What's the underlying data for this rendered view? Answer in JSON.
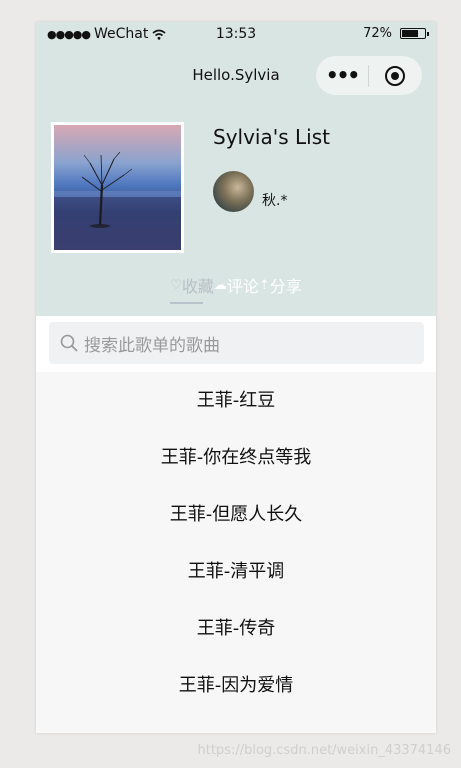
{
  "status_bar": {
    "carrier": "WeChat",
    "time": "13:53",
    "battery": "72%",
    "battery_level": 0.72
  },
  "nav": {
    "title": "Hello.Sylvia",
    "more_icon": "more-dots-icon",
    "close_icon": "target-icon"
  },
  "playlist": {
    "title": "Sylvia's List",
    "user_name": "秋.*"
  },
  "tabs": [
    {
      "icon": "♡",
      "label": "收藏"
    },
    {
      "icon": "☁",
      "label": "评论"
    },
    {
      "icon": "⇡",
      "label": "分享"
    }
  ],
  "search": {
    "placeholder": "搜索此歌单的歌曲"
  },
  "songs": [
    "王菲-红豆",
    "王菲-你在终点等我",
    "王菲-但愿人长久",
    "王菲-清平调",
    "王菲-传奇",
    "王菲-因为爱情"
  ],
  "watermark": "https://blog.csdn.net/weixin_43374146"
}
